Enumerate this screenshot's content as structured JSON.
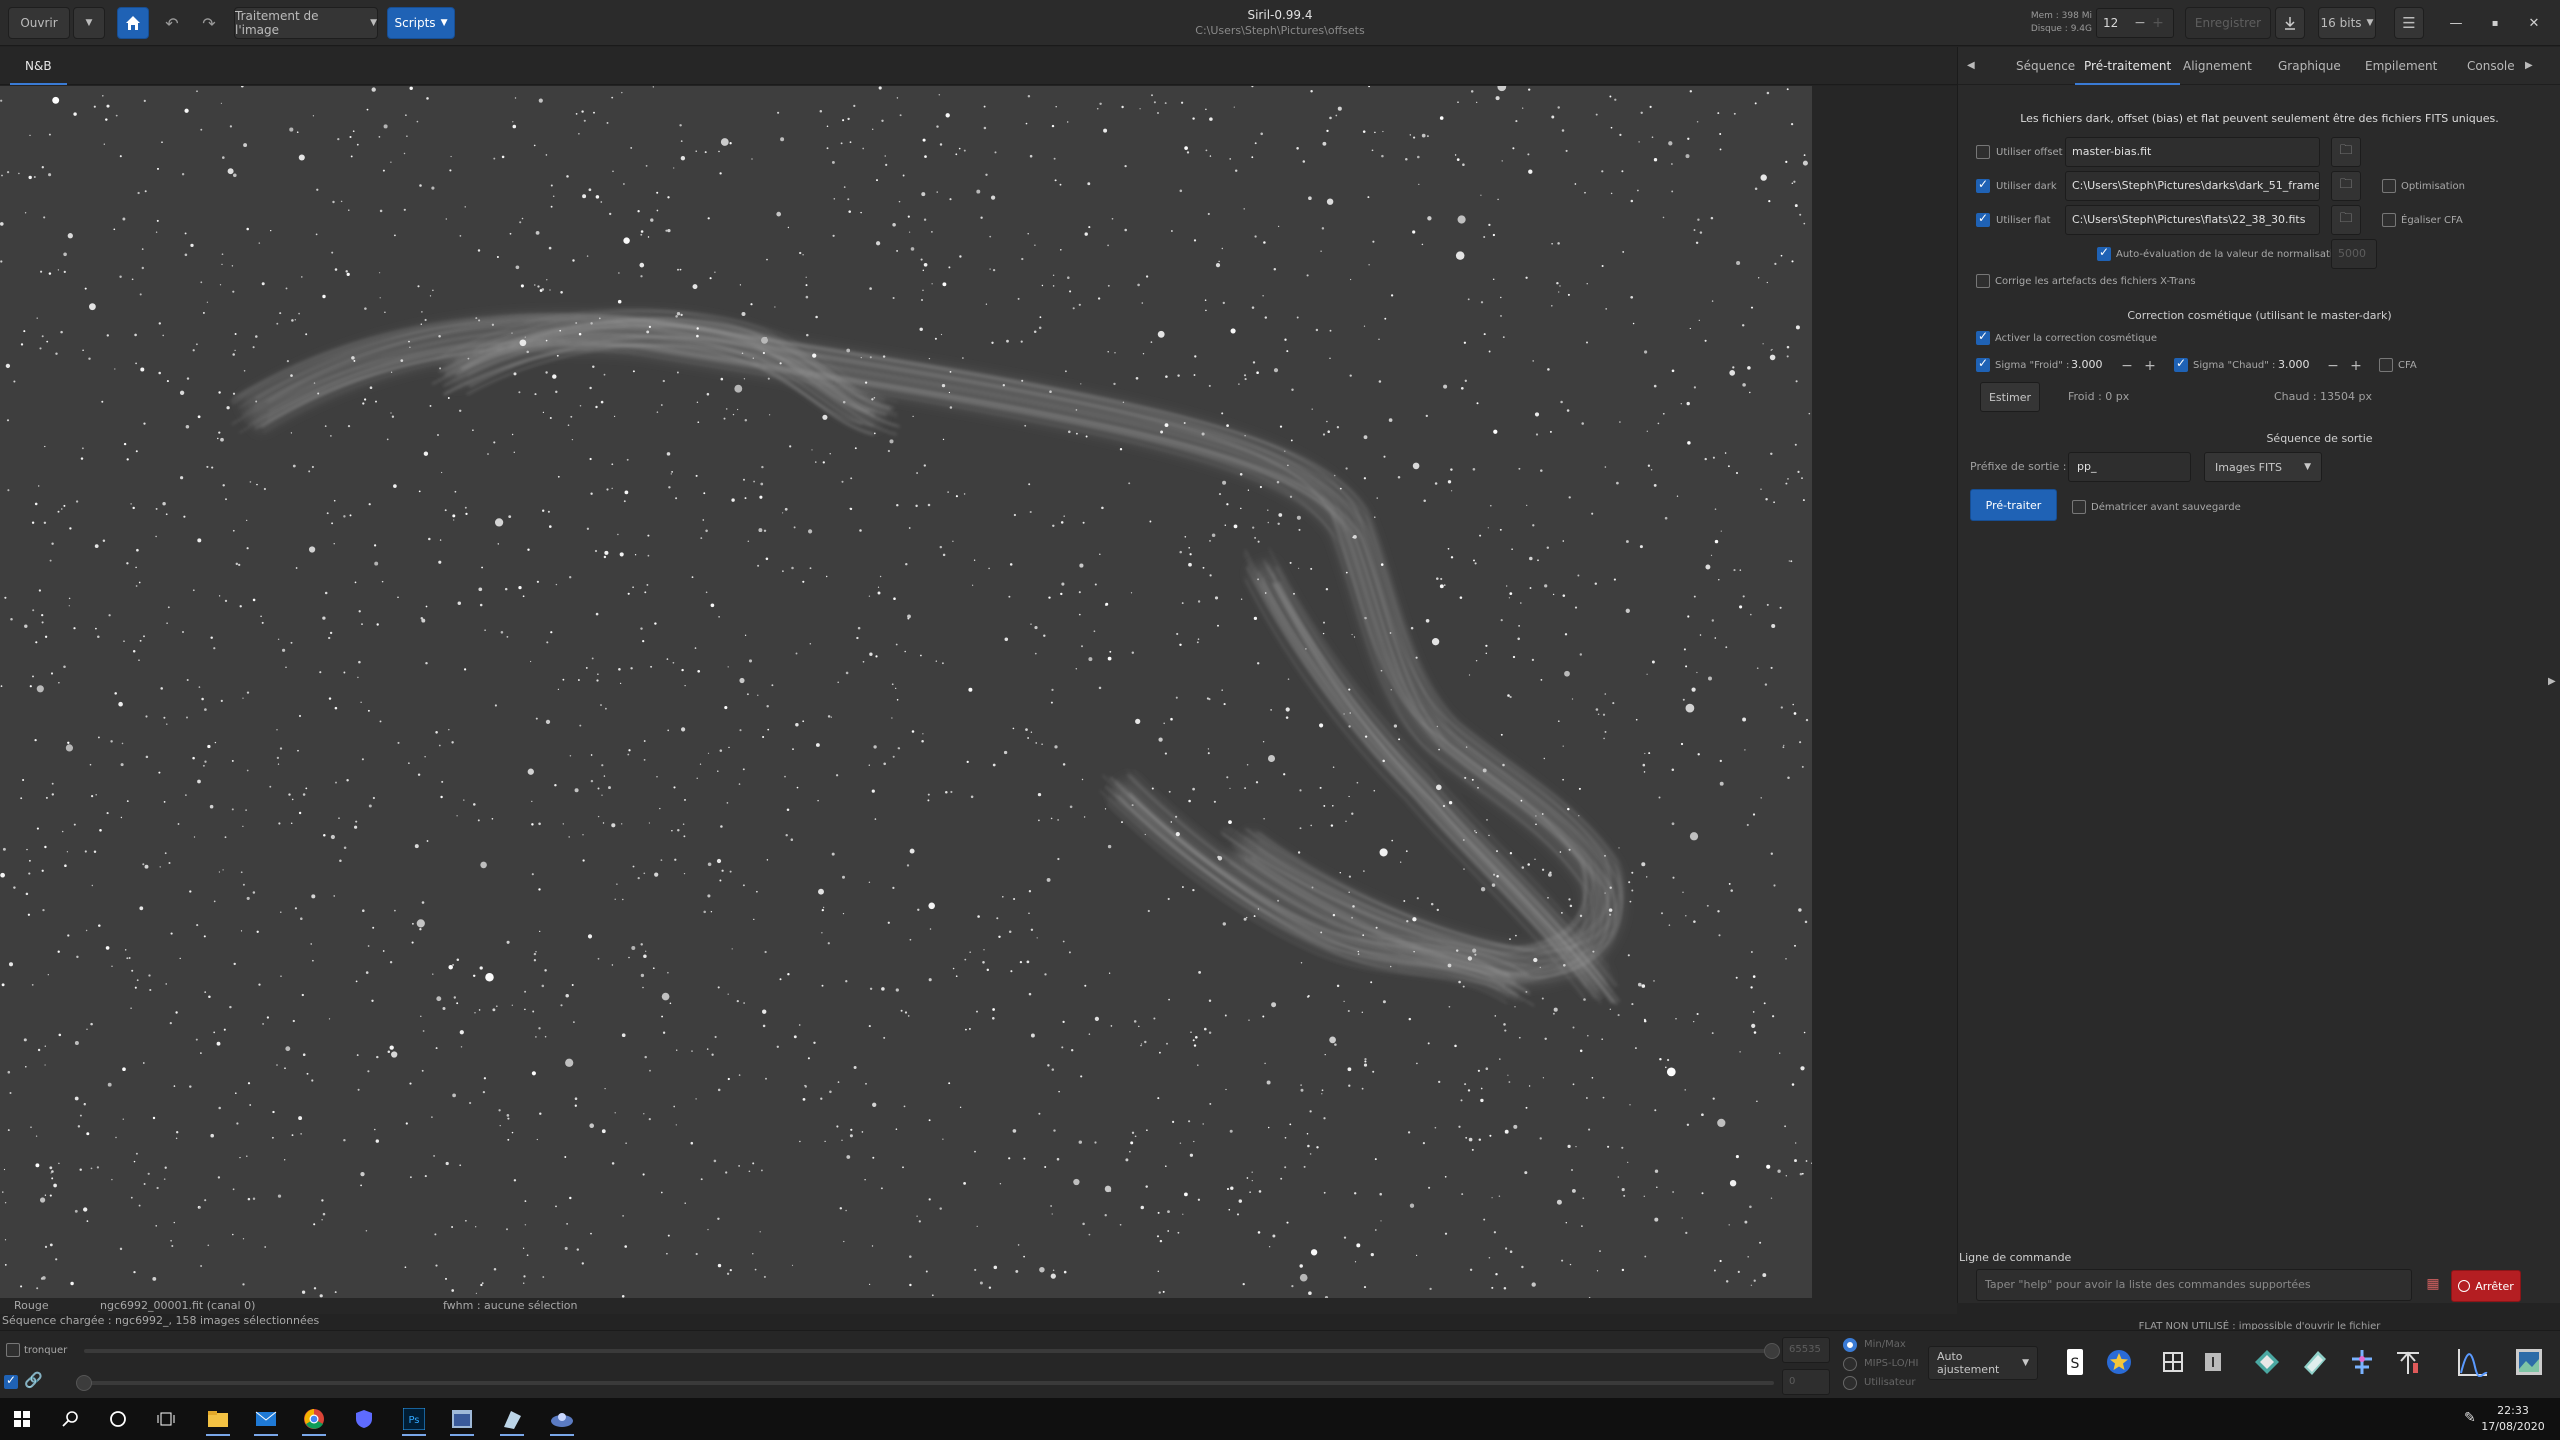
{
  "header": {
    "open_label": "Ouvrir",
    "image_processing_label": "Traitement de l'image",
    "scripts_label": "Scripts",
    "app_title": "Siril-0.99.4",
    "app_path": "C:\\Users\\Steph\\Pictures\\offsets",
    "mem_label": "Mem : 398 Mi",
    "disk_label": "Disque : 9.4G",
    "threads_value": "12",
    "save_label": "Enregistrer",
    "bitdepth_label": "16 bits"
  },
  "viewer": {
    "tab_label": "N&B",
    "status_channel": "Rouge",
    "status_file": "ngc6992_00001.fit (canal 0)",
    "status_fwhm": "fwhm : aucune sélection",
    "status_sequence": "Séquence chargée : ngc6992_, 158 images sélectionnées"
  },
  "panel": {
    "tabs": [
      "Séquence",
      "Pré-traitement",
      "Alignement",
      "Graphique",
      "Empilement",
      "Console"
    ],
    "active_tab": "Pré-traitement",
    "info": "Les fichiers dark, offset (bias) et flat peuvent seulement être des fichiers FITS uniques.",
    "use_offset_label": "Utiliser offset",
    "use_offset_value": "master-bias.fit",
    "use_dark_label": "Utiliser dark",
    "use_dark_value": "C:\\Users\\Steph\\Pictures\\darks\\dark_51_frames_",
    "use_flat_label": "Utiliser flat",
    "use_flat_value": "C:\\Users\\Steph\\Pictures\\flats\\22_38_30.fits",
    "optimization_label": "Optimisation",
    "equalize_cfa_label": "Égaliser CFA",
    "auto_norm_label": "Auto-évaluation de la valeur de normalisation",
    "auto_norm_value": "5000",
    "xtrans_label": "Corrige les artefacts des fichiers X-Trans",
    "cosmetic_title": "Correction cosmétique (utilisant le master-dark)",
    "cosmetic_enable_label": "Activer la correction cosmétique",
    "sigma_cold_label": "Sigma \"Froid\" :",
    "sigma_cold_value": "3.000",
    "sigma_hot_label": "Sigma \"Chaud\" :",
    "sigma_hot_value": "3.000",
    "cfa_label": "CFA",
    "estimate_label": "Estimer",
    "cold_px": "Froid : 0 px",
    "hot_px": "Chaud : 13504 px",
    "output_title": "Séquence de sortie",
    "prefix_label": "Préfixe de sortie :",
    "prefix_value": "pp_",
    "format_value": "Images FITS",
    "preprocess_label": "Pré-traiter",
    "debayer_label": "Dématricer avant sauvegarde",
    "cmd_title": "Ligne de commande",
    "cmd_placeholder": "Taper \"help\" pour avoir la liste des commandes supportées",
    "stop_label": "Arrêter",
    "cmd_status": "FLAT NON UTILISÉ : impossible d'ouvrir le fichier"
  },
  "bottom": {
    "truncate_label": "tronquer",
    "max_value": "65535",
    "min_value": "0",
    "radio_minmax": "Min/Max",
    "radio_mipslohi": "MIPS-LO/HI",
    "radio_user": "Utilisateur",
    "stretch_mode": "Auto ajustement"
  },
  "taskbar": {
    "time": "22:33",
    "date": "17/08/2020"
  },
  "colors": {
    "accent": "#1f62b5",
    "stop": "#b41e22"
  }
}
